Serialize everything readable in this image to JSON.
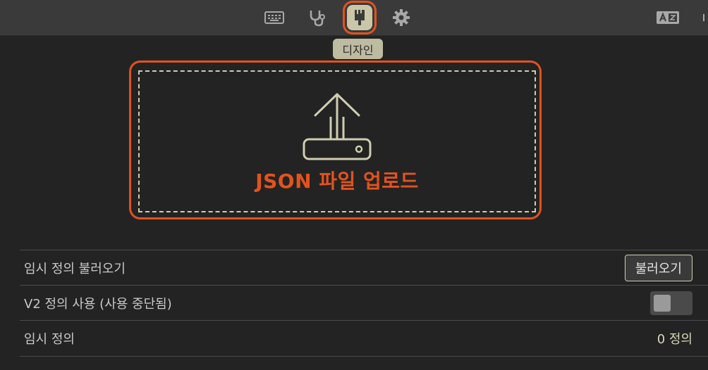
{
  "toolbar": {
    "icons": [
      "keyboard-icon",
      "stethoscope-icon",
      "brush-icon",
      "gear-icon",
      "translate-icon"
    ],
    "active_tooltip": "디자인"
  },
  "upload": {
    "label": "JSON 파일 업로드",
    "icon": "upload-icon"
  },
  "settings": {
    "load_temp": {
      "label": "임시 정의 불러오기",
      "button": "불러오기"
    },
    "v2": {
      "label": "V2 정의 사용 (사용 중단됨)",
      "enabled": false
    },
    "temp": {
      "label": "임시 정의",
      "value": "0 정의"
    }
  },
  "colors": {
    "accent": "#e2531e",
    "active_bg": "#c9c7a7",
    "bg": "#232323",
    "toolbar_bg": "#3a3a3a"
  }
}
